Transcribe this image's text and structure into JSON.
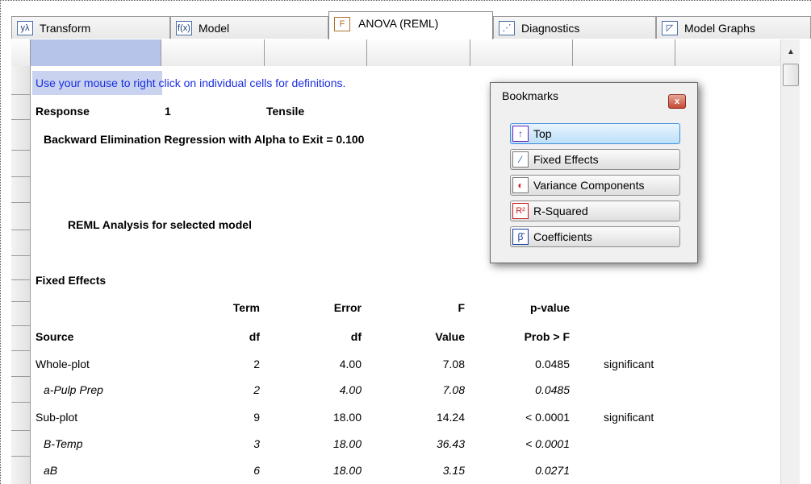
{
  "tabs": [
    {
      "label": "Transform",
      "icon": "y-lambda-icon",
      "glyph": "yλ"
    },
    {
      "label": "Model",
      "icon": "fx-icon",
      "glyph": "f(x)"
    },
    {
      "label": "ANOVA (REML)",
      "icon": "anova-icon",
      "glyph": "F"
    },
    {
      "label": "Diagnostics",
      "icon": "diagnostics-icon",
      "glyph": "⋰"
    },
    {
      "label": "Model Graphs",
      "icon": "model-graphs-icon",
      "glyph": "◸"
    }
  ],
  "report": {
    "hint": "Use your mouse to right click on individual cells for definitions.",
    "response_label": "Response",
    "response_number": "1",
    "response_name": "Tensile",
    "method": "Backward Elimination Regression with Alpha to Exit = 0.100",
    "analysis_title": "REML Analysis for selected model",
    "section_title": "Fixed Effects",
    "header_top": [
      "Term",
      "Error",
      "F",
      "p-value"
    ],
    "header_bottom": [
      "Source",
      "df",
      "df",
      "Value",
      "Prob > F"
    ],
    "rows": [
      {
        "source": "Whole-plot",
        "term_df": "2",
        "error_df": "4.00",
        "f": "7.08",
        "p": "0.0485",
        "note": "significant",
        "italic": false
      },
      {
        "source": "a-Pulp Prep",
        "term_df": "2",
        "error_df": "4.00",
        "f": "7.08",
        "p": "0.0485",
        "note": "",
        "italic": true
      },
      {
        "source": "Sub-plot",
        "term_df": "9",
        "error_df": "18.00",
        "f": "14.24",
        "p": "< 0.0001",
        "note": "significant",
        "italic": false
      },
      {
        "source": "B-Temp",
        "term_df": "3",
        "error_df": "18.00",
        "f": "36.43",
        "p": "< 0.0001",
        "note": "",
        "italic": true
      },
      {
        "source": "aB",
        "term_df": "6",
        "error_df": "18.00",
        "f": "3.15",
        "p": "0.0271",
        "note": "",
        "italic": true
      }
    ]
  },
  "bookmarks": {
    "title": "Bookmarks",
    "close_glyph": "x",
    "items": [
      {
        "label": "Top",
        "icon": "up-arrow-icon",
        "glyph": "↑"
      },
      {
        "label": "Fixed Effects",
        "icon": "slash-icon",
        "glyph": "∕"
      },
      {
        "label": "Variance Components",
        "icon": "variance-icon",
        "glyph": "◐"
      },
      {
        "label": "R-Squared",
        "icon": "r-squared-icon",
        "glyph": "R²"
      },
      {
        "label": "Coefficients",
        "icon": "beta-hat-icon",
        "glyph": "β̂"
      }
    ]
  },
  "colors": {
    "hint_text": "#1a2ee0",
    "selection": "#b6c4ea",
    "active_bookmark": "#bcdff8"
  }
}
